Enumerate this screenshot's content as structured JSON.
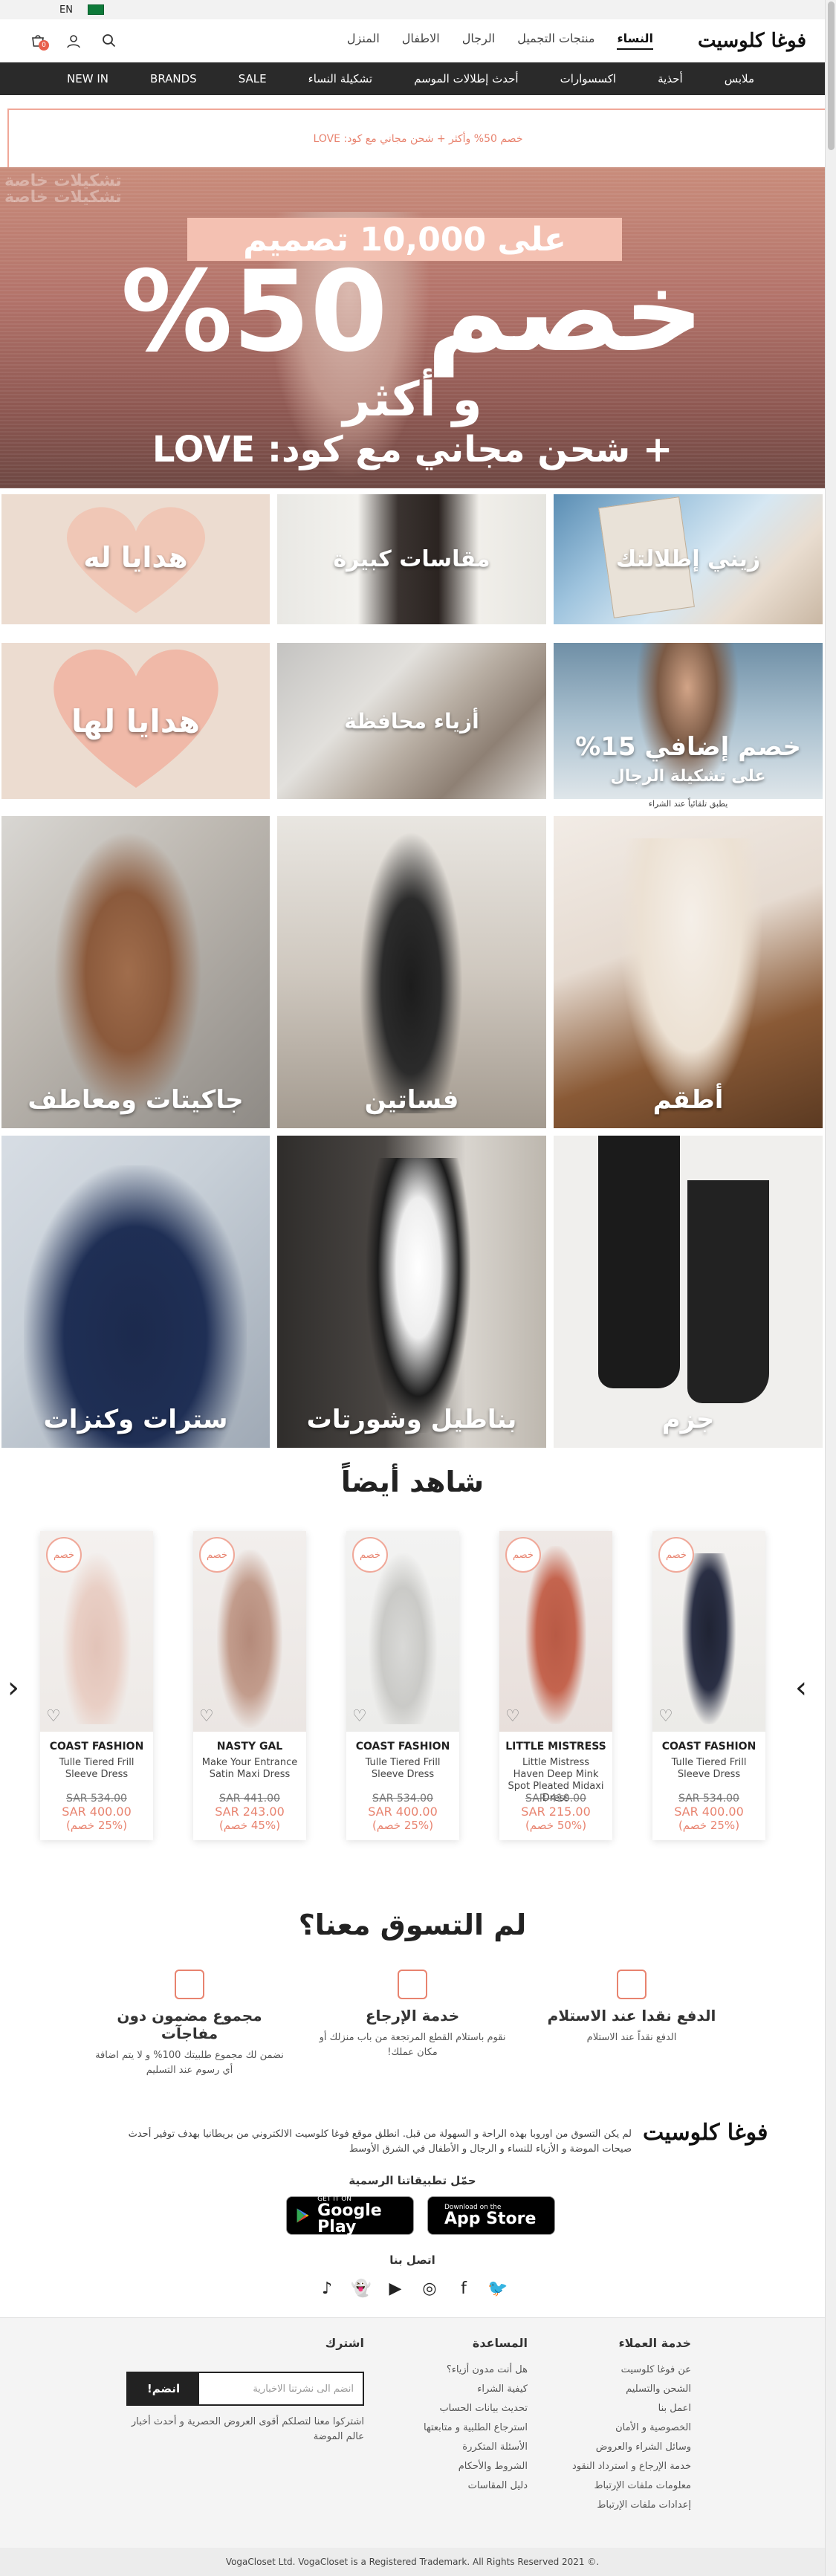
{
  "topbar": {
    "language": "EN"
  },
  "header": {
    "logo": "فوغا كلوسيت",
    "nav": [
      "النساء",
      "منتجات التجميل",
      "الرجال",
      "الاطفال",
      "المنزل"
    ],
    "cart_count": "0"
  },
  "catnav": [
    "ملابس",
    "أحذية",
    "اكسسوارات",
    "أحدث إطلالات الموسم",
    "تشكيلة النساء",
    "SALE",
    "BRANDS",
    "NEW IN"
  ],
  "promo": {
    "text": "خصم 50% وأكثر + شحن مجاني مع كود: LOVE"
  },
  "hero": {
    "ghost": "تشكيلات خاصة\nتشكيلات خاصة",
    "pill": "على 10,000 تصميم",
    "big": "خصم 50%",
    "mid": "و أكثر",
    "low": "+ شحن مجاني مع كود: LOVE"
  },
  "tiles_row1": [
    {
      "label": "زيني إطلالتك"
    },
    {
      "label": "مقاسات كبيرة"
    },
    {
      "label": "هدايا له"
    }
  ],
  "tiles_row2": [
    {
      "label": "خصم إضافي 15%",
      "sub": "على تشكيلة الرجال",
      "note": "يطبق تلقائياً عند الشراء"
    },
    {
      "label": "أزياء محافظة"
    },
    {
      "label": "هدايا لها"
    }
  ],
  "tiles_row3": [
    {
      "label": "أطقم"
    },
    {
      "label": "فساتين"
    },
    {
      "label": "جاكيتات ومعاطف"
    }
  ],
  "tiles_row4": [
    {
      "label": "جزم"
    },
    {
      "label": "بناطيل وشورتات"
    },
    {
      "label": "سترات وكنزات"
    }
  ],
  "also_view": {
    "title": "شاهد أيضاً",
    "products": [
      {
        "tag": "خصم",
        "brand": "COAST FASHION",
        "name": "Tulle Tiered Frill Sleeve Dress",
        "old_price": "SAR 534.00",
        "new_price": "SAR 400.00",
        "discount": "(25% خصم)"
      },
      {
        "tag": "خصم",
        "brand": "LITTLE MISTRESS",
        "name": "Little Mistress Haven Deep Mink Spot Pleated Midaxi Dress",
        "old_price": "SAR 410.00",
        "new_price": "SAR 215.00",
        "discount": "(50% خصم)"
      },
      {
        "tag": "خصم",
        "brand": "COAST FASHION",
        "name": "Tulle Tiered Frill Sleeve Dress",
        "old_price": "SAR 534.00",
        "new_price": "SAR 400.00",
        "discount": "(25% خصم)"
      },
      {
        "tag": "خصم",
        "brand": "NASTY GAL",
        "name": "Make Your Entrance Satin Maxi Dress",
        "old_price": "SAR 441.00",
        "new_price": "SAR 243.00",
        "discount": "(45% خصم)"
      },
      {
        "tag": "خصم",
        "brand": "COAST FASHION",
        "name": "Tulle Tiered Frill Sleeve Dress",
        "old_price": "SAR 534.00",
        "new_price": "SAR 400.00",
        "discount": "(25% خصم)"
      }
    ]
  },
  "why": {
    "title": "لم التسوق معنا؟",
    "features": [
      {
        "title": "الدفع نقدا عند الاستلام",
        "desc": "الدفع نقداً عند الاستلام"
      },
      {
        "title": "خدمة الإرجاع",
        "desc": "نقوم باستلام القطع المرتجعة من باب منزلك أو مكان عملك!"
      },
      {
        "title": "مجموع مضمون دون مفاجآت",
        "desc": "نضمن لك مجموع طلبيتك 100% و لا يتم اضافة أي رسوم عند التسليم"
      }
    ]
  },
  "about": {
    "logo": "فوغا كلوسيت",
    "text": "لم يكن التسوق من اوروبا بهذه الراحة و السهولة من قبل. انطلق موقع فوغا كلوسيت الالكتروني من بريطانيا بهدف توفير أحدث صيحات الموضة و الأزياء للنساء و الرجال و الأطفال في الشرق الأوسط"
  },
  "apps": {
    "title": "حمّل تطبيقاتنا الرسمية",
    "appstore_small": "Download on the",
    "appstore_big": "App Store",
    "google_small": "GET IT ON",
    "google_big": "Google Play"
  },
  "social": {
    "title": "اتصل بنا"
  },
  "footer": {
    "customer_service": {
      "title": "خدمة العملاء",
      "links": [
        "عن فوغا كلوسيت",
        "الشحن والتسليم",
        "اعمل بنا",
        "الخصوصية و الأمان",
        "وسائل الشراء والعروض",
        "خدمة الإرجاع و استرداد النقود",
        "معلومات ملفات الإرتباط",
        "إعدادات ملفات الإرتباط"
      ]
    },
    "help": {
      "title": "المساعدة",
      "links": [
        "هل أنت مدون أزياء؟",
        "كيفية الشراء",
        "تحديث بيانات الحساب",
        "استرجاع الطلبية و متابعتها",
        "الأسئلة المتكررة",
        "الشروط والأحكام",
        "دليل المقاسات"
      ]
    },
    "subscribe": {
      "title": "اشترك",
      "placeholder": "انضم الى نشرتنا الاخبارية",
      "button": "انضم!",
      "note": "اشتركوا معنا لتصلكم أقوى العروض الحصرية و أحدث أخبار عالم الموضة"
    }
  },
  "copyright": "VogaCloset Ltd. VogaCloset is a Registered Trademark. All Rights Reserved 2021 ©.",
  "colors": {
    "accent": "#e8836f",
    "dark_nav": "#2a2a2a",
    "pill": "#f4c1b2"
  }
}
